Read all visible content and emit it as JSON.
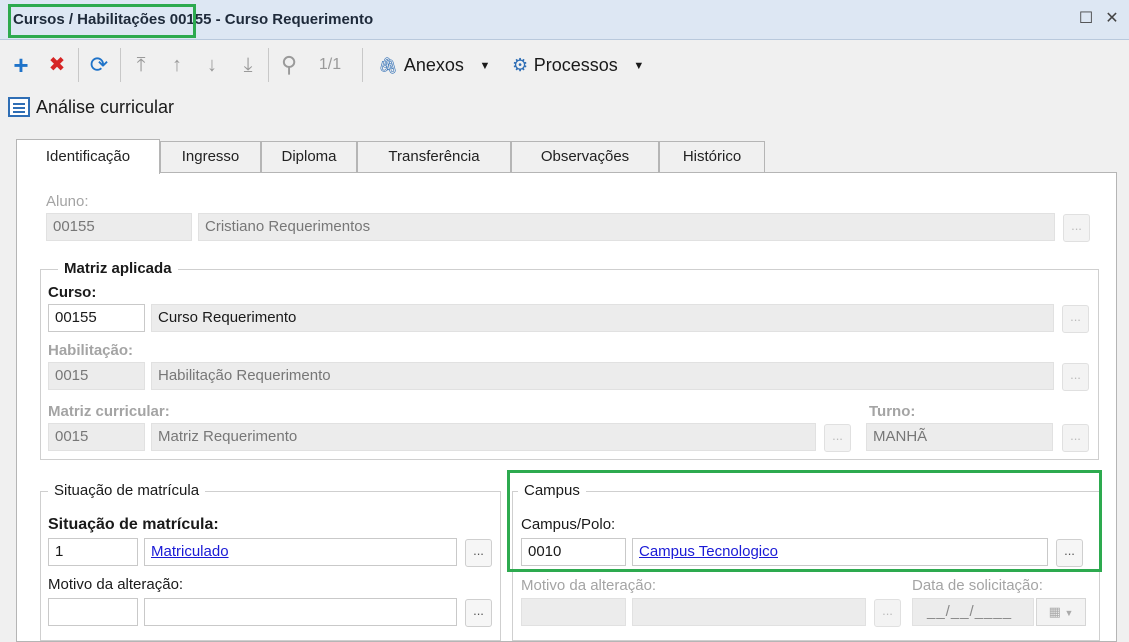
{
  "window": {
    "title_prefix": "Cursos / Habilitações",
    "title_rest": "00155 - Curso Requerimento",
    "maximize_glyph": "☐",
    "close_glyph": "✕"
  },
  "toolbar": {
    "add_glyph": "+",
    "delete_glyph": "✖",
    "refresh_glyph": "⟳",
    "first_glyph": "⤒",
    "prev_glyph": "↑",
    "next_glyph": "↓",
    "last_glyph": "⤓",
    "search_glyph": "⚲",
    "pager": "1/1",
    "attachments_label": "Anexos",
    "processes_label": "Processos",
    "caret_glyph": "▼",
    "paperclip_glyph": "🖇",
    "gear_glyph": "⚙"
  },
  "subtitle": "Análise curricular",
  "tabs": [
    "Identificação",
    "Ingresso",
    "Diploma",
    "Transferência",
    "Observações",
    "Histórico"
  ],
  "student": {
    "label": "Aluno:",
    "code": "00155",
    "name": "Cristiano Requerimentos"
  },
  "matrix": {
    "group_title": "Matriz aplicada",
    "course_label": "Curso:",
    "course_code": "00155",
    "course_name": "Curso Requerimento",
    "habilitation_label": "Habilitação:",
    "habilitation_code": "0015",
    "habilitation_name": "Habilitação Requerimento",
    "curricular_label": "Matriz curricular:",
    "curricular_code": "0015",
    "curricular_name": "Matriz Requerimento",
    "shift_label": "Turno:",
    "shift_value": "MANHÃ"
  },
  "enrollment": {
    "group_title": "Situação de matrícula",
    "status_label": "Situação de matrícula:",
    "status_code": "1",
    "status_name": "Matriculado",
    "reason_label": "Motivo da alteração:",
    "reason_code": "",
    "reason_name": ""
  },
  "campus": {
    "group_title": "Campus",
    "campus_label": "Campus/Polo:",
    "campus_code": "0010",
    "campus_name": "Campus Tecnologico",
    "reason_label": "Motivo da alteração:",
    "request_date_label": "Data de solicitação:",
    "request_date_value": "__/__/____"
  },
  "ellipsis": "...",
  "colors": {
    "highlight": "#2daa4f",
    "add": "#1f73c9",
    "delete": "#d62424",
    "link": "#1a1ad6"
  }
}
